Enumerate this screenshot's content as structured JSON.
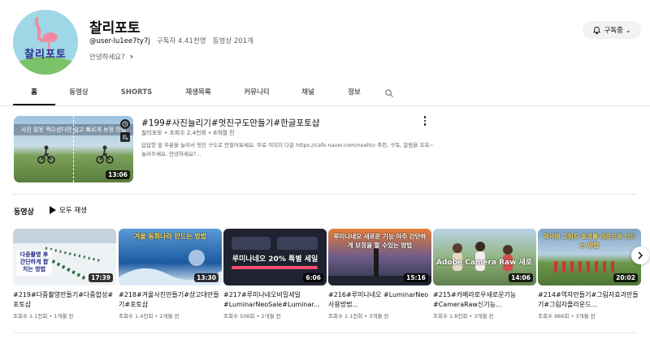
{
  "channel": {
    "avatar_text": "찰리포토",
    "name": "찰리포토",
    "handle": "@user-lu1ee7ty7j",
    "subscribers": "구독자 4.41천명",
    "video_count": "동영상 201개",
    "description": "안녕하세요?",
    "subscribe_label": "구독중"
  },
  "tabs": [
    {
      "label": "홈"
    },
    {
      "label": "동영상"
    },
    {
      "label": "SHORTS"
    },
    {
      "label": "재생목록"
    },
    {
      "label": "커뮤니티"
    },
    {
      "label": "채널"
    },
    {
      "label": "정보"
    }
  ],
  "featured": {
    "thumb_caption": "사진 잘못 찍으셨다면 쉽고 빠르게 보정 방법",
    "duration": "13:06",
    "title": "#199#사진늘리기#멋진구도만들기#한글포토샵",
    "meta": "찰리포토 • 조회수 2.4천회 • 8개월 전",
    "description": "답답한 앞 부분을 늘려서 멋진 구도로 만들어보세요. 무료 이미지 다운 https://cafe.naver.com/noahtv 추천, 구독, 알림을 꼬옥~ 눌러주세요. 안녕하세요?..."
  },
  "shelf": {
    "title": "동영상",
    "play_all": "모두 재생",
    "videos": [
      {
        "caption": "다중촬영 후 간단하게 합치는 방법",
        "duration": "17:39",
        "title": "#219#다중촬영만들기#다중합성#포토샵",
        "meta": "조회수 1.1천회 • 1개월 전",
        "bg": "#c7d3dc"
      },
      {
        "caption": "겨울 동화나라 만드는 방법",
        "duration": "13:30",
        "title": "#218#겨울사진만들기#상고대만들기#포토샵",
        "meta": "조회수 1.4천회 • 2개월 전",
        "bg": "#2a6fb8"
      },
      {
        "caption": "루미나네오 20% 특별 세일",
        "duration": "6:06",
        "title": "#217#루미나네오비밀세일#LuminarNeoSale#Luminar...",
        "meta": "조회수 508회 • 2개월 전",
        "bg": "#1f2230"
      },
      {
        "caption": "루미나네오 새로운 기능 아주 간단하게 보정을 할 수있는 방법",
        "duration": "15:16",
        "title": "#216#루미나네오 #LuminarNeo사용방법...",
        "meta": "조회수 1.1천회 • 3개월 전",
        "bg": "#3d4a6b"
      },
      {
        "caption": "Adobe Camera Raw 새로운 기능",
        "duration": "14:06",
        "title": "#215#카메라로우새로운기능 #CameraRaw신기능...",
        "meta": "조회수 1.8천회 • 3개월 전",
        "bg": "#5f7f4d"
      },
      {
        "caption": "역사에 그림자 효과를 라운드로 만드는 방법",
        "duration": "20:02",
        "title": "#214#역자만들기#그림자효과만들기#그림자플라운드...",
        "meta": "조회수 986회 • 3개월 전",
        "bg": "#7da3c4"
      }
    ]
  }
}
